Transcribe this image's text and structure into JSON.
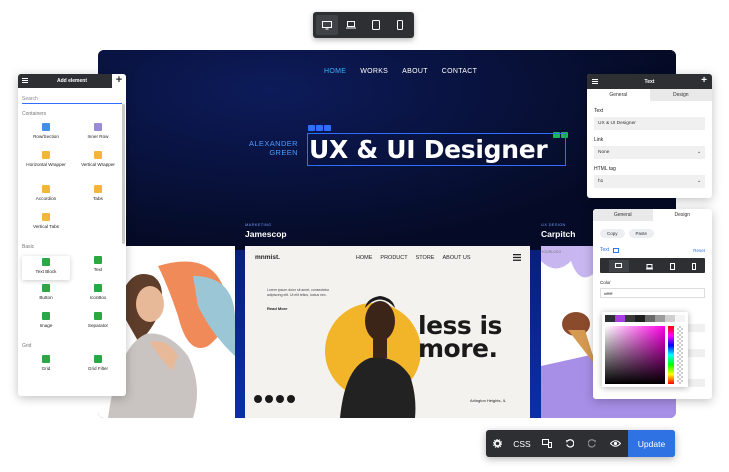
{
  "device_bar": {
    "icons": [
      "desktop-icon",
      "laptop-icon",
      "tablet-icon",
      "mobile-icon"
    ],
    "active": "desktop"
  },
  "site": {
    "nav": [
      "HOME",
      "WORKS",
      "ABOUT",
      "CONTACT"
    ],
    "hero_name_line1": "ALEXANDER",
    "hero_name_line2": "GREEN",
    "hero_title": "UX & UI Designer",
    "cards": [
      {
        "tag": "MARKETING",
        "title": "Jamescop"
      },
      {
        "tag": "UX DESIGN",
        "title": "Carpitch"
      }
    ],
    "mid_card": {
      "logo": "mnmist.",
      "links": [
        "HOME",
        "PRODUCT",
        "STORE",
        "ABOUT US"
      ],
      "headline_line1": "less is",
      "headline_line2": "more.",
      "blurb": "Lorem ipsum dolor sit amet, consectetur adipiscing elit. Ut elit tellus, luctus nec.",
      "read_more": "Read More",
      "address": "Arlington Heights, IL"
    },
    "right_card_small": "YOURLOGO"
  },
  "left_panel": {
    "title": "Add element",
    "search_placeholder": "Search",
    "section_containers": "Containers",
    "containers": [
      {
        "label": "Row/Section",
        "icon": "row-section-icon",
        "color": "#3f8ef0"
      },
      {
        "label": "Inner Row",
        "icon": "inner-row-icon",
        "color": "#9a8bd8"
      },
      {
        "label": "Horizontal Wrapper",
        "icon": "horizontal-wrapper-icon",
        "color": "#f3b63a"
      },
      {
        "label": "Vertical Wrapper",
        "icon": "vertical-wrapper-icon",
        "color": "#f3b63a"
      },
      {
        "label": "Accordion",
        "icon": "accordion-icon",
        "color": "#f3b63a"
      },
      {
        "label": "Tabs",
        "icon": "tabs-icon",
        "color": "#f3b63a"
      },
      {
        "label": "Vertical Tabs",
        "icon": "vertical-tabs-icon",
        "color": "#f3b63a"
      }
    ],
    "section_basic": "Basic",
    "basic": [
      {
        "label": "Text Block",
        "icon": "text-block-icon",
        "color": "#2aa845"
      },
      {
        "label": "Text",
        "icon": "text-icon",
        "color": "#2aa845"
      },
      {
        "label": "Button",
        "icon": "button-icon",
        "color": "#2aa845"
      },
      {
        "label": "IconBox",
        "icon": "iconbox-icon",
        "color": "#2aa845"
      },
      {
        "label": "Image",
        "icon": "image-icon",
        "color": "#2aa845"
      },
      {
        "label": "Separator",
        "icon": "separator-icon",
        "color": "#2aa845"
      }
    ],
    "section_grid": "Grid",
    "grid": [
      {
        "label": "Grid",
        "icon": "grid-icon",
        "color": "#2aa845"
      },
      {
        "label": "Grid Filter",
        "icon": "grid-filter-icon",
        "color": "#2aa845"
      }
    ]
  },
  "text_panel": {
    "title": "Text",
    "tab_general": "General",
    "tab_design": "Design",
    "text_label": "Text",
    "text_value": "UX & UI Designer",
    "link_label": "Link",
    "link_value": "None",
    "tag_label": "HTML tag",
    "tag_value": "h1"
  },
  "style_panel": {
    "tab_general": "General",
    "tab_design": "Design",
    "copy_label": "Copy",
    "paste_label": "Paste",
    "element_label": "Text",
    "reset_label": "Reset",
    "color_label": "Color",
    "color_value": "#ffffff"
  },
  "bottom_bar": {
    "css_label": "CSS",
    "update_label": "Update"
  }
}
